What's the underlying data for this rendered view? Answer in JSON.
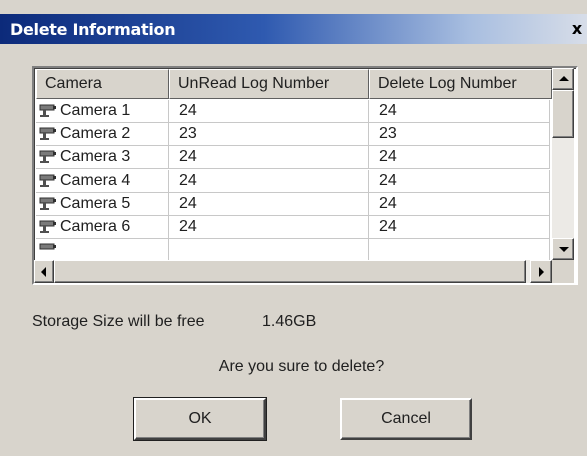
{
  "window": {
    "title": "Delete Information",
    "close_glyph": "x",
    "title_gradient": [
      "#0c2a7a",
      "#2f5ab0",
      "#a8bee0",
      "#d7dde8"
    ],
    "face_color": "#d8d4cc"
  },
  "list": {
    "columns": [
      "Camera",
      "UnRead Log Number",
      "Delete Log Number"
    ],
    "row_icon": "camera-icon",
    "rows": [
      {
        "camera": "Camera 1",
        "unread": "24",
        "delete": "24"
      },
      {
        "camera": "Camera 2",
        "unread": "23",
        "delete": "23"
      },
      {
        "camera": "Camera 3",
        "unread": "24",
        "delete": "24"
      },
      {
        "camera": "Camera 4",
        "unread": "24",
        "delete": "24"
      },
      {
        "camera": "Camera 5",
        "unread": "24",
        "delete": "24"
      },
      {
        "camera": "Camera 6",
        "unread": "24",
        "delete": "24"
      }
    ]
  },
  "storage": {
    "label": "Storage Size will be free",
    "value": "1.46GB"
  },
  "confirm": {
    "question": "Are you sure to delete?"
  },
  "buttons": {
    "ok_label": "OK",
    "cancel_label": "Cancel"
  }
}
